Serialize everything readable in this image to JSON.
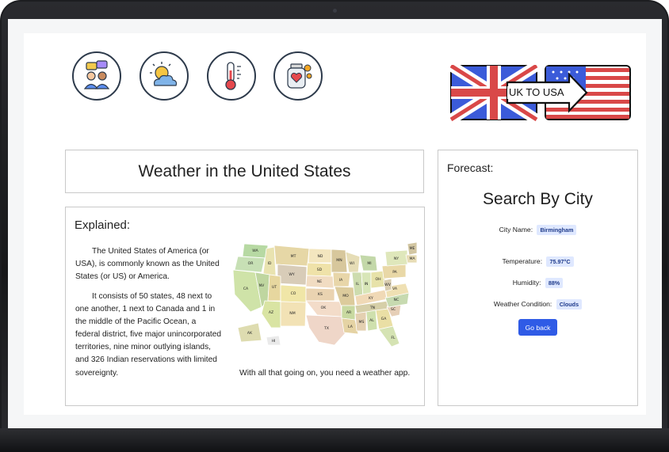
{
  "nav": {
    "icons": [
      "people-chat-icon",
      "sun-cloud-icon",
      "thermometer-icon",
      "heart-jar-icon"
    ],
    "flag_button_label": "UK TO USA"
  },
  "header": {
    "title": "Weather in the United States"
  },
  "explained": {
    "heading": "Explained:",
    "paragraph_1": "The United States of America (or USA), is commonly known as the United States (or US) or America.",
    "paragraph_2": "It consists of 50 states, 48 next to one another, 1 next to Canada and 1 in the middle of the Pacific Ocean, a federal district, five major unincorporated territories, nine minor outlying islands, and 326 Indian reservations with limited sovereignty.",
    "map_caption": "With all that going on, you need a weather app.",
    "map_states": [
      "WA",
      "OR",
      "ID",
      "MT",
      "ND",
      "MN",
      "WI",
      "MI",
      "NY",
      "VT",
      "NH",
      "ME",
      "MA",
      "CT",
      "RI",
      "NJ",
      "DE",
      "MD",
      "PA",
      "OH",
      "IN",
      "IL",
      "IA",
      "NE",
      "SD",
      "WY",
      "NV",
      "CA",
      "UT",
      "CO",
      "KS",
      "MO",
      "KY",
      "WV",
      "VA",
      "NC",
      "TN",
      "AR",
      "OK",
      "NM",
      "AZ",
      "TX",
      "LA",
      "MS",
      "AL",
      "GA",
      "SC",
      "FL",
      "AK",
      "HI"
    ]
  },
  "forecast": {
    "label": "Forecast:",
    "search_title": "Search By City",
    "city_label": "City Name:",
    "city_value": "Birmingham",
    "temperature_label": "Temperature:",
    "temperature_value": "75.97°C",
    "humidity_label": "Humidity:",
    "humidity_value": "88%",
    "condition_label": "Weather Condition:",
    "condition_value": "Clouds",
    "go_back_label": "Go back"
  },
  "colors": {
    "accent": "#2f5be6",
    "badge_bg": "#dfe8ff",
    "bezel": "#1c1d20"
  }
}
